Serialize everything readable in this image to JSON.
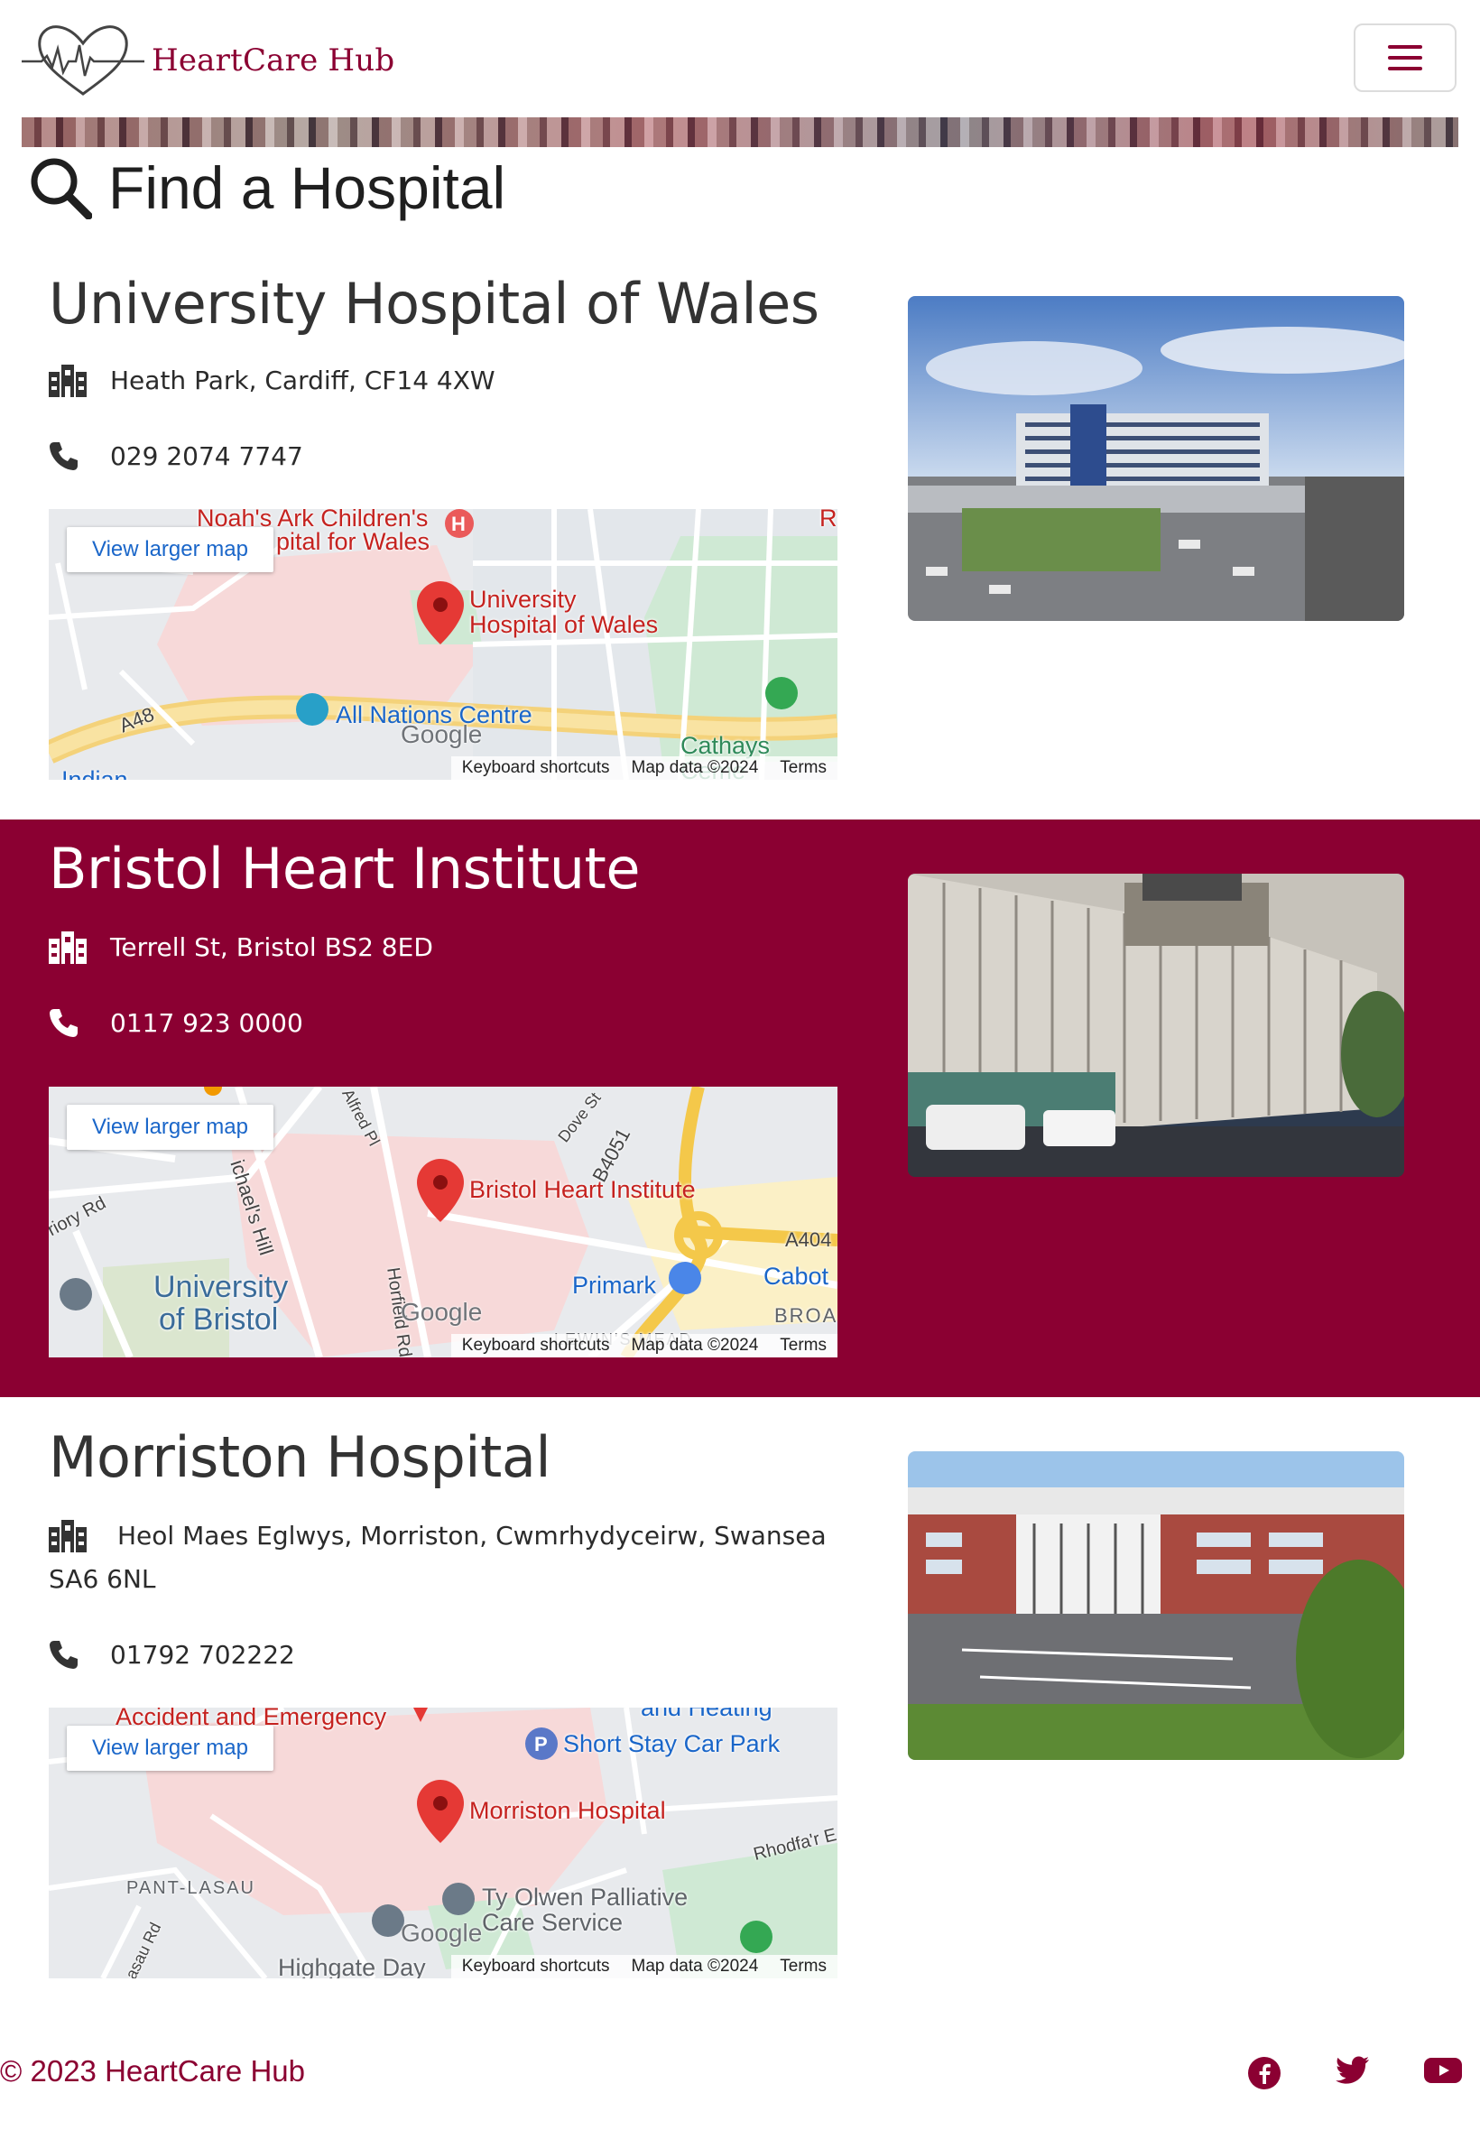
{
  "brand": {
    "name": "HeartCare Hub",
    "color": "#8b0032"
  },
  "nav": {
    "menu_icon": "hamburger-icon"
  },
  "page": {
    "title": "Find a Hospital",
    "title_icon": "search-icon"
  },
  "hospitals": [
    {
      "name": "University Hospital of Wales",
      "address": "Heath Park, Cardiff, CF14 4XW",
      "phone": "029 2074 7747",
      "map": {
        "link": "View larger map",
        "labels": [
          "Noah's Ark Children's",
          "pital for Wales",
          "University",
          "Hospital of Wales",
          "All Nations Centre",
          "A48",
          "Cathays Ceme",
          "Indian",
          "Ro"
        ],
        "footer": [
          "Keyboard shortcuts",
          "Map data ©2024",
          "Terms"
        ],
        "google": "Google"
      }
    },
    {
      "name": "Bristol Heart Institute",
      "address": "Terrell St, Bristol BS2 8ED",
      "phone": "0117 923 0000",
      "map": {
        "link": "View larger map",
        "labels": [
          "Bristol Heart Institute",
          "University",
          "of Bristol",
          "Primark",
          "Cabot",
          "A404",
          "B4051",
          "BROAD",
          "LEWIN'S MEAD",
          "Alfred Pl",
          "Dove St",
          "riory Rd",
          "ichael's Hill",
          "Horfield Rd"
        ],
        "footer": [
          "Keyboard shortcuts",
          "Map data ©2024",
          "Terms"
        ],
        "google": "Google"
      }
    },
    {
      "name": "Morriston Hospital",
      "address_line1": "Heol Maes Eglwys, Morriston, Cwmrhydyceirw, Swansea",
      "address_line2": "SA6 6NL",
      "phone": "01792 702222",
      "map": {
        "link": "View larger map",
        "labels": [
          "Accident and Emergency",
          "and Heating",
          "Short Stay Car Park",
          "Morriston Hospital",
          "Rhodfa'r E",
          "PANT-LASAU",
          "Ty Olwen Palliative",
          "Care Service",
          "Highgate Day",
          "Lasau Rd"
        ],
        "footer": [
          "Keyboard shortcuts",
          "Map data ©2024",
          "Terms"
        ],
        "google": "Google"
      }
    }
  ],
  "footer": {
    "copyright": "© 2023 HeartCare Hub",
    "social": [
      "facebook-icon",
      "twitter-icon",
      "youtube-icon"
    ]
  }
}
